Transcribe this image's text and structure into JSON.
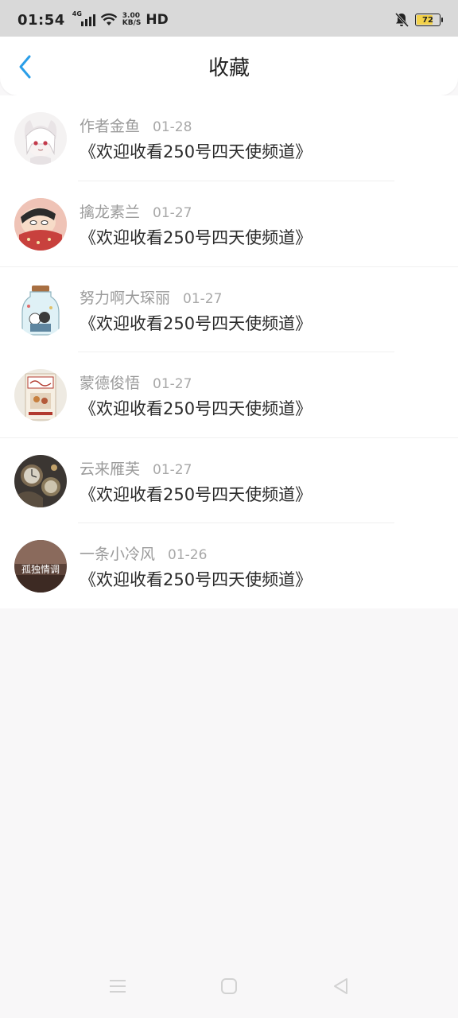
{
  "status_bar": {
    "time": "01:54",
    "network": "4G",
    "speed_value": "3.00",
    "speed_unit": "KB/S",
    "hd": "HD",
    "battery": "72",
    "battery_level": 0.72
  },
  "header": {
    "title": "收藏"
  },
  "favorites": [
    {
      "author": "作者金鱼",
      "date": "01-28",
      "title": "《欢迎收看250号四天使频道》"
    },
    {
      "author": "擒龙素兰",
      "date": "01-27",
      "title": "《欢迎收看250号四天使频道》"
    },
    {
      "author": "努力啊大琛丽",
      "date": "01-27",
      "title": "《欢迎收看250号四天使频道》"
    },
    {
      "author": "蒙德俊悟",
      "date": "01-27",
      "title": "《欢迎收看250号四天使频道》"
    },
    {
      "author": "云来雁芙",
      "date": "01-27",
      "title": "《欢迎收看250号四天使频道》"
    },
    {
      "author": "一条小冷风",
      "date": "01-26",
      "title": "《欢迎收看250号四天使频道》"
    }
  ],
  "avatar_5_text": "孤独情调",
  "colors": {
    "accent": "#2a9ee8",
    "background": "#f8f7f8"
  }
}
